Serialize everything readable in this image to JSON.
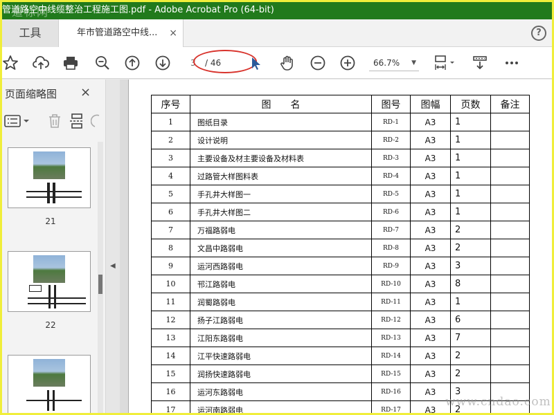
{
  "window": {
    "title": "管道路空中线缆整治工程施工图.pdf - Adobe Acrobat Pro (64-bit)",
    "overlay_logo": "道标网"
  },
  "tabs": {
    "tools_label": "工具",
    "doc_tab_label": "年市管道路空中线...",
    "close_glyph": "×",
    "help_glyph": "?"
  },
  "toolbar": {
    "current_page": "3",
    "page_total": "/ 46",
    "zoom_value": "66.7%",
    "zoom_arrow": "▼",
    "icons": [
      "bookmark-star-icon",
      "cloud-upload-icon",
      "print-icon",
      "zoom-search-icon",
      "page-up-icon",
      "page-down-icon",
      "select-arrow-icon",
      "hand-tool-icon",
      "zoom-out-icon",
      "zoom-in-icon",
      "page-fit-icon",
      "scroll-mode-icon",
      "more-icon"
    ],
    "annotation_color": "#d8332c"
  },
  "sidebar": {
    "title": "页面缩略图",
    "close_glyph": "×",
    "thumbnails": [
      {
        "page_number": "21"
      },
      {
        "page_number": "22"
      },
      {
        "page_number": ""
      }
    ]
  },
  "document": {
    "headers": [
      "序号",
      "图　　名",
      "图号",
      "图幅",
      "页数",
      "备注"
    ],
    "rows": [
      {
        "no": "1",
        "name": "图纸目录",
        "code": "RD-1",
        "size": "A3",
        "pages": "1",
        "note": ""
      },
      {
        "no": "2",
        "name": "设计说明",
        "code": "RD-2",
        "size": "A3",
        "pages": "1",
        "note": ""
      },
      {
        "no": "3",
        "name": "主要设备及材主要设备及材料表",
        "code": "RD-3",
        "size": "A3",
        "pages": "1",
        "note": ""
      },
      {
        "no": "4",
        "name": "过路管大样图料表",
        "code": "RD-4",
        "size": "A3",
        "pages": "1",
        "note": ""
      },
      {
        "no": "5",
        "name": "手孔井大样图一",
        "code": "RD-5",
        "size": "A3",
        "pages": "1",
        "note": ""
      },
      {
        "no": "6",
        "name": "手孔井大样图二",
        "code": "RD-6",
        "size": "A3",
        "pages": "1",
        "note": ""
      },
      {
        "no": "7",
        "name": "万福路弱电",
        "code": "RD-7",
        "size": "A3",
        "pages": "2",
        "note": ""
      },
      {
        "no": "8",
        "name": "文昌中路弱电",
        "code": "RD-8",
        "size": "A3",
        "pages": "2",
        "note": ""
      },
      {
        "no": "9",
        "name": "运河西路弱电",
        "code": "RD-9",
        "size": "A3",
        "pages": "3",
        "note": ""
      },
      {
        "no": "10",
        "name": "邗江路弱电",
        "code": "RD-10",
        "size": "A3",
        "pages": "8",
        "note": ""
      },
      {
        "no": "11",
        "name": "润蜀路弱电",
        "code": "RD-11",
        "size": "A3",
        "pages": "1",
        "note": ""
      },
      {
        "no": "12",
        "name": "扬子江路弱电",
        "code": "RD-12",
        "size": "A3",
        "pages": "6",
        "note": ""
      },
      {
        "no": "13",
        "name": "江阳东路弱电",
        "code": "RD-13",
        "size": "A3",
        "pages": "7",
        "note": ""
      },
      {
        "no": "14",
        "name": "江平快速路弱电",
        "code": "RD-14",
        "size": "A3",
        "pages": "2",
        "note": ""
      },
      {
        "no": "15",
        "name": "润扬快速路弱电",
        "code": "RD-15",
        "size": "A3",
        "pages": "2",
        "note": ""
      },
      {
        "no": "16",
        "name": "运河东路弱电",
        "code": "RD-16",
        "size": "A3",
        "pages": "3",
        "note": ""
      },
      {
        "no": "17",
        "name": "运河南路弱电",
        "code": "RD-17",
        "size": "A3",
        "pages": "2",
        "note": ""
      }
    ]
  },
  "footer": {
    "watermark": "www.cndao.com"
  },
  "colors": {
    "titlebar": "#217a1c",
    "outer_border": "#f0ee3a",
    "annotation": "#d8332c"
  }
}
